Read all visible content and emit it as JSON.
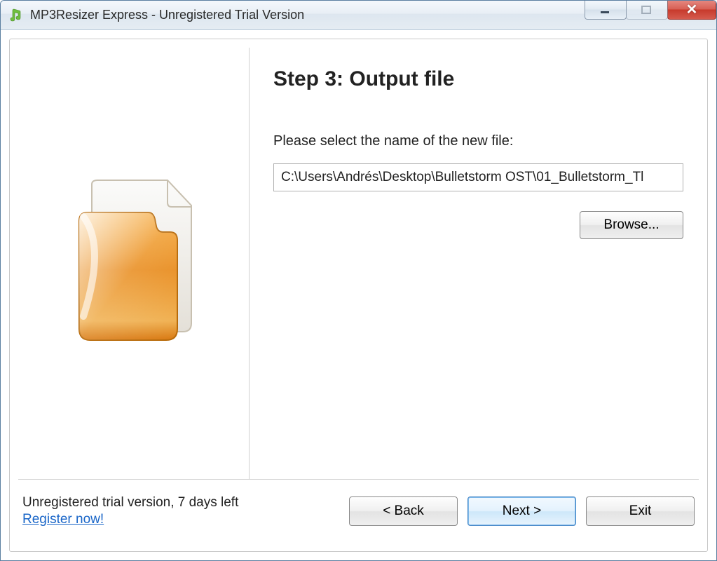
{
  "window": {
    "title": "MP3Resizer Express - Unregistered Trial Version"
  },
  "main": {
    "heading": "Step 3: Output file",
    "instruction": "Please select the name of the new file:",
    "path_value": "C:\\Users\\Andrés\\Desktop\\Bulletstorm OST\\01_Bulletstorm_Tl",
    "browse_label": "Browse..."
  },
  "footer": {
    "trial_text": "Unregistered trial version, 7 days left",
    "register_link": "Register now!",
    "back_label": "< Back",
    "next_label": "Next >",
    "exit_label": "Exit"
  }
}
